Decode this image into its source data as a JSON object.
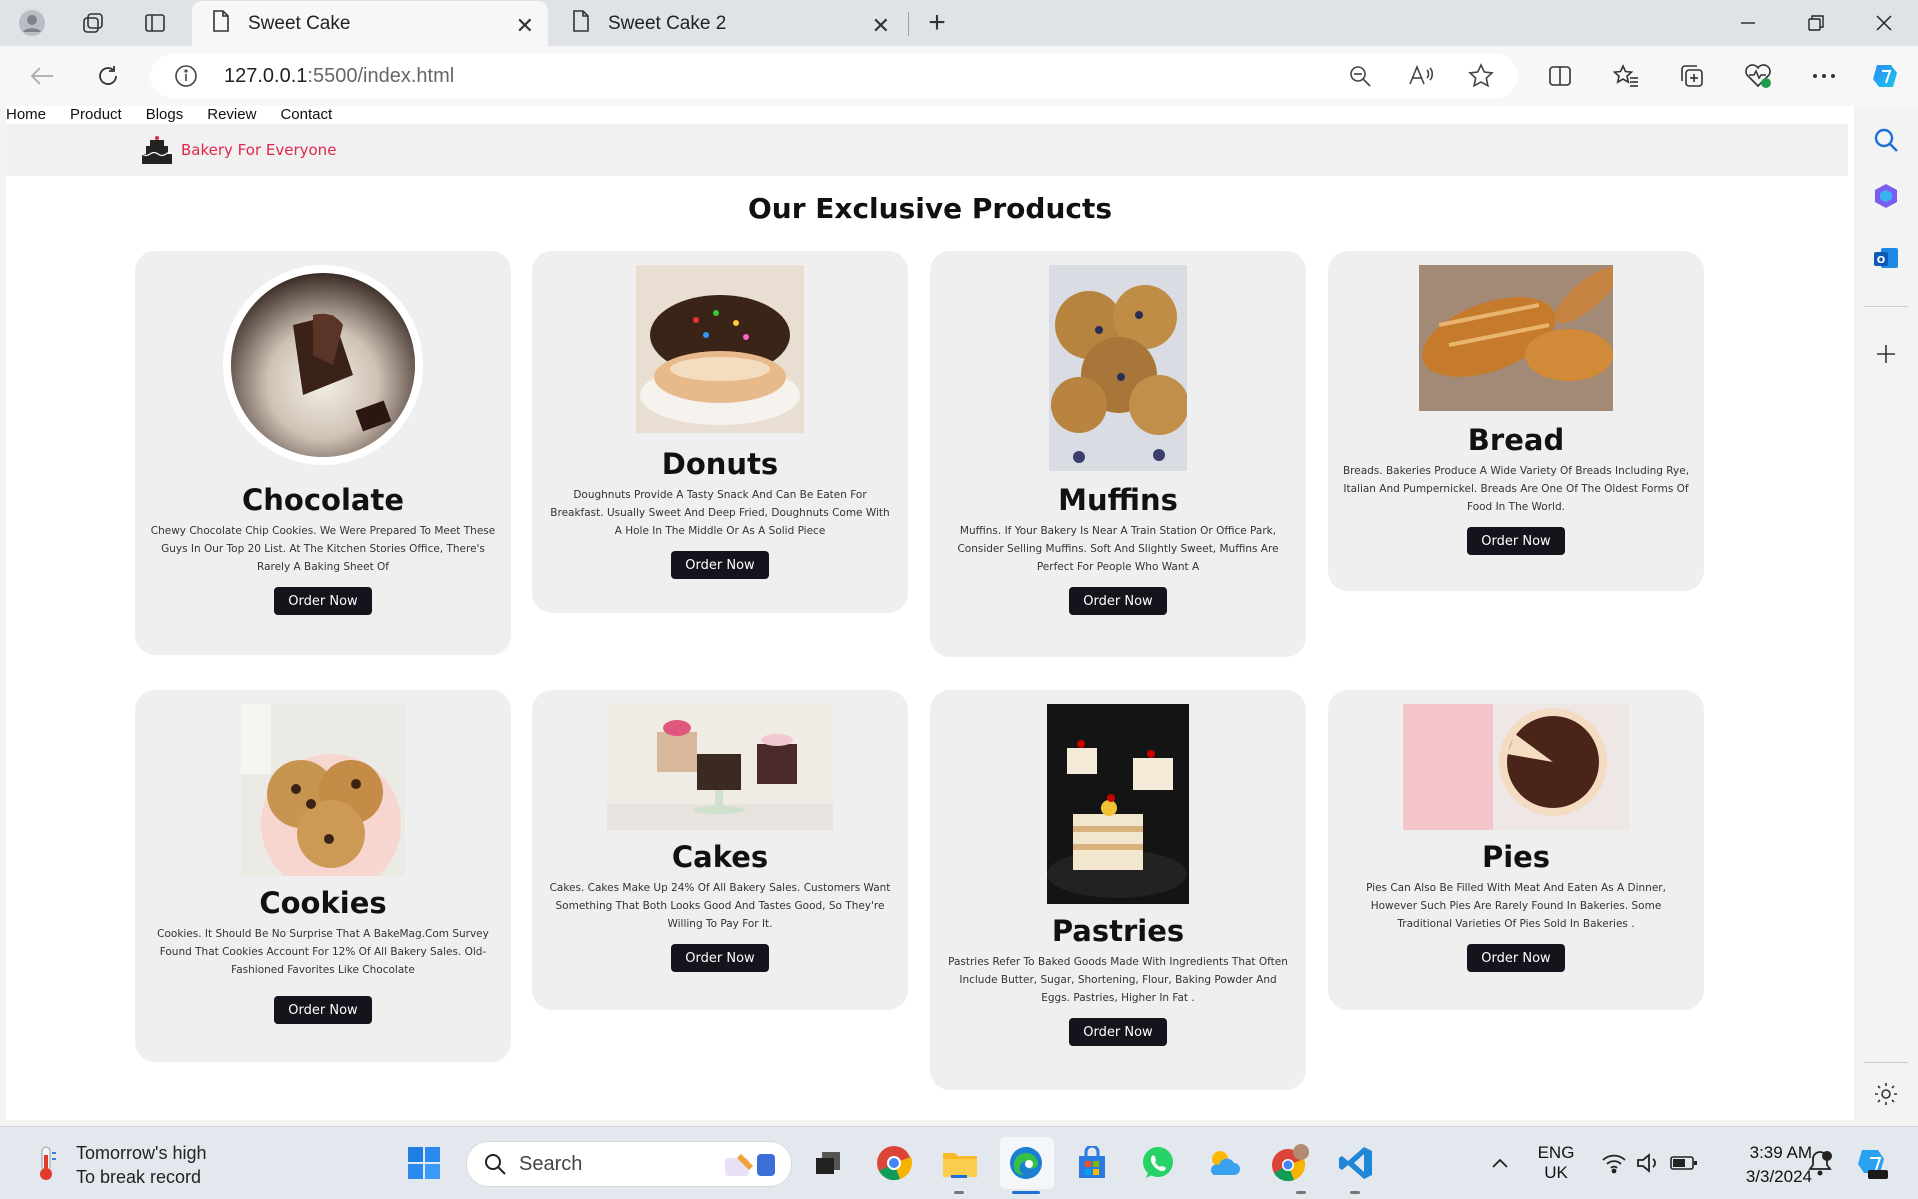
{
  "browser": {
    "tabs": [
      {
        "title": "Sweet Cake",
        "active": true
      },
      {
        "title": "Sweet Cake 2",
        "active": false
      }
    ],
    "url_host": "127.0.0.1",
    "url_path": ":5500/index.html"
  },
  "site": {
    "nav": [
      "Home",
      "Product",
      "Blogs",
      "Review",
      "Contact"
    ],
    "brand": "Bakery For Everyone",
    "section_title": "Our Exclusive Products",
    "order_label": "Order Now",
    "products": [
      {
        "name": "Chocolate",
        "desc": "Chewy Chocolate Chip Cookies. We Were Prepared To Meet These Guys In Our Top 20 List. At The Kitchen Stories Office, There's Rarely A Baking Sheet Of"
      },
      {
        "name": "Donuts",
        "desc": "Doughnuts Provide A Tasty Snack And Can Be Eaten For Breakfast. Usually Sweet And Deep Fried, Doughnuts Come With A Hole In The Middle Or As A Solid Piece"
      },
      {
        "name": "Muffins",
        "desc": "Muffins. If Your Bakery Is Near A Train Station Or Office Park, Consider Selling Muffins. Soft And Slightly Sweet, Muffins Are Perfect For People Who Want A"
      },
      {
        "name": "Bread",
        "desc": "Breads. Bakeries Produce A Wide Variety Of Breads Including Rye, Italian And Pumpernickel. Breads Are One Of The Oldest Forms Of Food In The World."
      },
      {
        "name": "Cookies",
        "desc": "Cookies. It Should Be No Surprise That A BakeMag.Com Survey Found That Cookies Account For 12% Of All Bakery Sales. Old-Fashioned Favorites Like Chocolate"
      },
      {
        "name": "Cakes",
        "desc": "Cakes. Cakes Make Up 24% Of All Bakery Sales. Customers Want Something That Both Looks Good And Tastes Good, So They're Willing To Pay For It."
      },
      {
        "name": "Pastries",
        "desc": "Pastries Refer To Baked Goods Made With Ingredients That Often Include Butter, Sugar, Shortening, Flour, Baking Powder And Eggs. Pastries, Higher In Fat ."
      },
      {
        "name": "Pies",
        "desc": "Pies Can Also Be Filled With Meat And Eaten As A Dinner, However Such Pies Are Rarely Found In Bakeries. Some Traditional Varieties Of Pies Sold In Bakeries ."
      }
    ]
  },
  "taskbar": {
    "weather_line1": "Tomorrow's high",
    "weather_line2": "To break record",
    "search_label": "Search",
    "lang_line1": "ENG",
    "lang_line2": "UK",
    "time": "3:39 AM",
    "date": "3/3/2024"
  },
  "colors": {
    "brand": "#e0264b",
    "button": "#14141c",
    "card": "#efefef"
  }
}
